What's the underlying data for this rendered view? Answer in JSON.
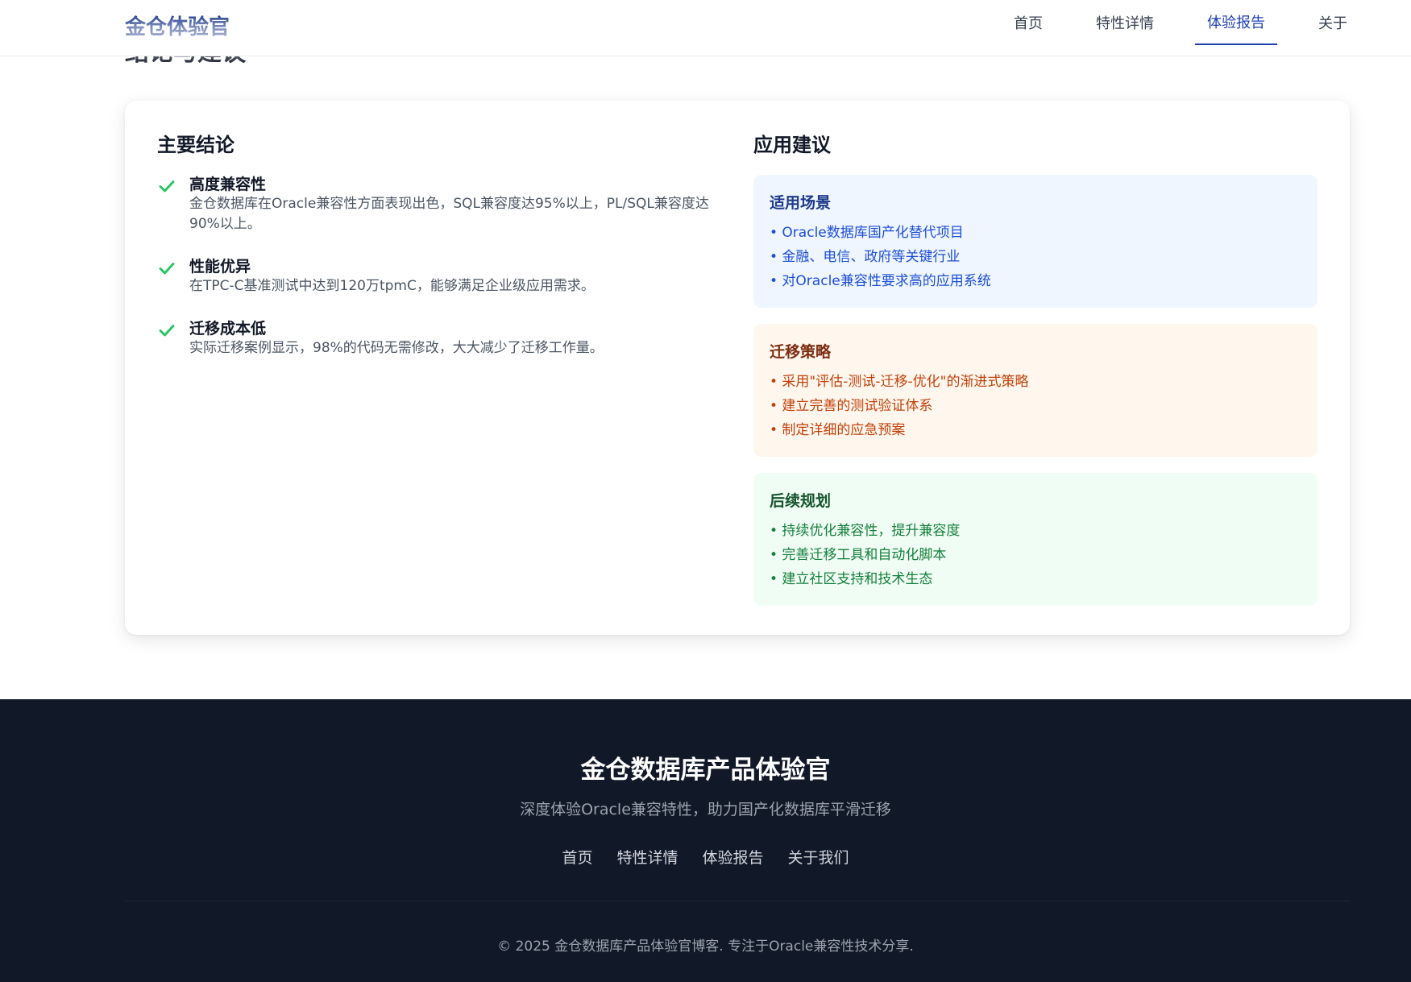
{
  "header": {
    "brand": "金仓体验官",
    "nav": [
      {
        "label": "首页",
        "active": false
      },
      {
        "label": "特性详情",
        "active": false
      },
      {
        "label": "体验报告",
        "active": true
      },
      {
        "label": "关于",
        "active": false
      }
    ]
  },
  "section": {
    "heading_partial": "结论与建议"
  },
  "conclusions": {
    "title": "主要结论",
    "items": [
      {
        "title": "高度兼容性",
        "desc": "金仓数据库在Oracle兼容性方面表现出色，SQL兼容度达95%以上，PL/SQL兼容度达90%以上。"
      },
      {
        "title": "性能优异",
        "desc": "在TPC-C基准测试中达到120万tpmC，能够满足企业级应用需求。"
      },
      {
        "title": "迁移成本低",
        "desc": "实际迁移案例显示，98%的代码无需修改，大大减少了迁移工作量。"
      }
    ],
    "icon": "check-icon",
    "icon_color": "#22c55e"
  },
  "advice": {
    "title": "应用建议",
    "cards": [
      {
        "title": "适用场景",
        "items": [
          "• Oracle数据库国产化替代项目",
          "• 金融、电信、政府等关键行业",
          "• 对Oracle兼容性要求高的应用系统"
        ]
      },
      {
        "title": "迁移策略",
        "items": [
          "• 采用\"评估-测试-迁移-优化\"的渐进式策略",
          "• 建立完善的测试验证体系",
          "• 制定详细的应急预案"
        ]
      },
      {
        "title": "后续规划",
        "items": [
          "• 持续优化兼容性，提升兼容度",
          "• 完善迁移工具和自动化脚本",
          "• 建立社区支持和技术生态"
        ]
      }
    ]
  },
  "footer": {
    "title": "金仓数据库产品体验官",
    "subtitle": "深度体验Oracle兼容特性，助力国产化数据库平滑迁移",
    "links": [
      "首页",
      "特性详情",
      "体验报告",
      "关于我们"
    ],
    "copyright": "© 2025 金仓数据库产品体验官博客. 专注于Oracle兼容性技术分享."
  },
  "colors": {
    "brand": "#1e3a8a",
    "footer_bg": "#111827",
    "blue_card": "#eff6ff",
    "orange_card": "#fff7ed",
    "green_card": "#f0fdf4"
  }
}
